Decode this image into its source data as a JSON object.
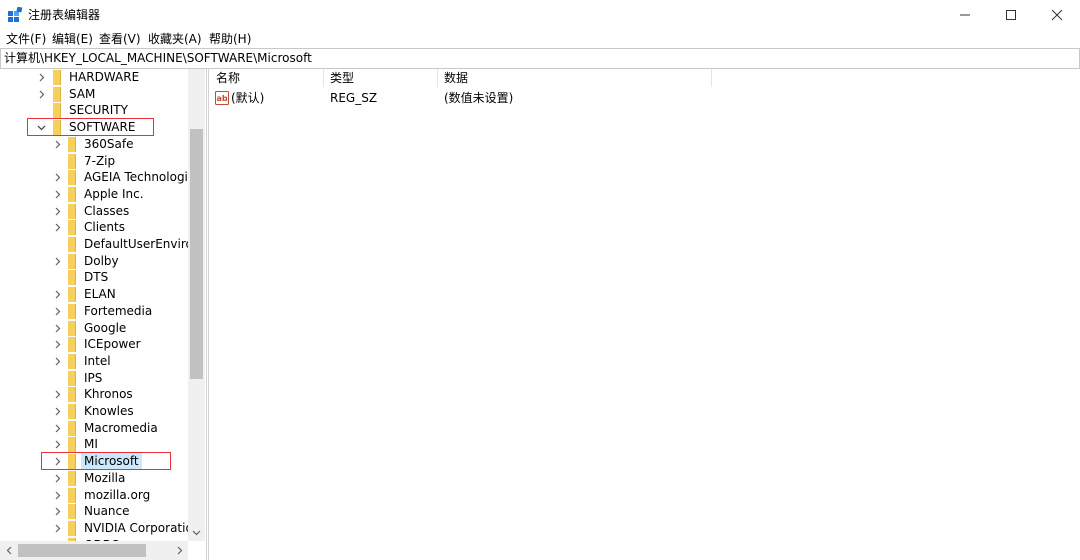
{
  "window": {
    "title": "注册表编辑器",
    "controls": {
      "minimize": "minimize-icon",
      "maximize": "maximize-icon",
      "close": "close-icon"
    }
  },
  "menu": [
    "文件(F)",
    "编辑(E)",
    "查看(V)",
    "收藏夹(A)",
    "帮助(H)"
  ],
  "address": "计算机\\HKEY_LOCAL_MACHINE\\SOFTWARE\\Microsoft",
  "tree": {
    "root_children": [
      {
        "label": "HARDWARE",
        "expander": "collapsed"
      },
      {
        "label": "SAM",
        "expander": "collapsed"
      },
      {
        "label": "SECURITY",
        "expander": "none"
      },
      {
        "label": "SOFTWARE",
        "expander": "expanded",
        "highlighted": true
      }
    ],
    "software_children": [
      {
        "label": "360Safe",
        "expander": "collapsed"
      },
      {
        "label": "7-Zip",
        "expander": "none"
      },
      {
        "label": "AGEIA Technologie",
        "expander": "collapsed"
      },
      {
        "label": "Apple Inc.",
        "expander": "collapsed"
      },
      {
        "label": "Classes",
        "expander": "collapsed"
      },
      {
        "label": "Clients",
        "expander": "collapsed"
      },
      {
        "label": "DefaultUserEnviron",
        "expander": "none"
      },
      {
        "label": "Dolby",
        "expander": "collapsed"
      },
      {
        "label": "DTS",
        "expander": "none"
      },
      {
        "label": "ELAN",
        "expander": "collapsed"
      },
      {
        "label": "Fortemedia",
        "expander": "collapsed"
      },
      {
        "label": "Google",
        "expander": "collapsed"
      },
      {
        "label": "ICEpower",
        "expander": "collapsed"
      },
      {
        "label": "Intel",
        "expander": "collapsed"
      },
      {
        "label": "IPS",
        "expander": "none"
      },
      {
        "label": "Khronos",
        "expander": "collapsed"
      },
      {
        "label": "Knowles",
        "expander": "collapsed"
      },
      {
        "label": "Macromedia",
        "expander": "collapsed"
      },
      {
        "label": "MI",
        "expander": "collapsed"
      },
      {
        "label": "Microsoft",
        "expander": "collapsed",
        "selected": true,
        "highlighted": true
      },
      {
        "label": "Mozilla",
        "expander": "collapsed"
      },
      {
        "label": "mozilla.org",
        "expander": "collapsed"
      },
      {
        "label": "Nuance",
        "expander": "collapsed"
      },
      {
        "label": "NVIDIA Corporatio",
        "expander": "collapsed"
      },
      {
        "label": "ODBC",
        "expander": "collapsed"
      }
    ]
  },
  "columns": [
    "名称",
    "类型",
    "数据"
  ],
  "values": [
    {
      "name": "(默认)",
      "type": "REG_SZ",
      "data": "(数值未设置)",
      "icon": "string-value-icon"
    }
  ],
  "colors": {
    "folder": "#f6cf5c",
    "selection": "#cce8ff",
    "highlight_box": "#e8313a"
  }
}
